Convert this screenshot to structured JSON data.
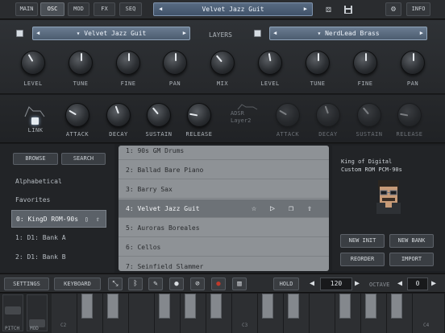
{
  "topbar": {
    "tabs": [
      {
        "label": "MAIN",
        "active": false
      },
      {
        "label": "OSC",
        "active": true
      },
      {
        "label": "MOD",
        "active": false
      },
      {
        "label": "FX",
        "active": false
      },
      {
        "label": "SEQ",
        "active": false
      }
    ],
    "preset_name": "Velvet Jazz Guit",
    "prev_arrow": "◀",
    "next_arrow": "▶",
    "dice_icon": "⚄",
    "save_icon": "💾",
    "gear_icon": "⚙",
    "info_label": "INFO"
  },
  "layers_label": "LAYERS",
  "osc_left": {
    "preset": "Velvet Jazz Guit",
    "knobs": [
      "LEVEL",
      "TUNE",
      "FINE",
      "PAN"
    ]
  },
  "mix_label": "MIX",
  "osc_right": {
    "preset": "NerdLead Brass",
    "knobs": [
      "LEVEL",
      "TUNE",
      "FINE",
      "PAN"
    ]
  },
  "env_left": {
    "link_label": "LINK",
    "knobs": [
      "ATTACK",
      "DECAY",
      "SUSTAIN",
      "RELEASE"
    ]
  },
  "env_right": {
    "adsr_line1": "ADSR",
    "adsr_line2": "Layer2",
    "knobs": [
      "ATTACK",
      "DECAY",
      "SUSTAIN",
      "RELEASE"
    ]
  },
  "browser": {
    "browse_label": "BROWSE",
    "search_label": "SEARCH",
    "categories": [
      "Alphabetical",
      "Favorites",
      "0: KingD ROM-90s",
      "1: D1: Bank A",
      "2: D1: Bank B"
    ],
    "selected_category": 2,
    "presets": [
      "1: 90s GM Drums",
      "2: Ballad Bare Piano",
      "3: Barry Sax",
      "4: Velvet Jazz Guit",
      "5: Auroras Boreales",
      "6: Cellos",
      "7: Seinfield Slammer"
    ],
    "selected_preset": 3
  },
  "info_panel": {
    "line1": "King of Digital",
    "line2": "Custom ROM PCM-90s",
    "buttons": [
      "NEW INIT",
      "NEW BANK",
      "REORDER",
      "IMPORT"
    ]
  },
  "bottombar": {
    "settings_label": "SETTINGS",
    "keyboard_label": "KEYBOARD",
    "hold_label": "HOLD",
    "tempo_value": "120",
    "octave_label": "OCTAVE",
    "octave_value": "0"
  },
  "keyboard": {
    "pitch_label": "PITCH",
    "mod_label": "MOD",
    "octave_labels": [
      "C2",
      "C3",
      "C4"
    ]
  },
  "colors": {
    "accent_select": "#5a6c82",
    "selected_row": "#6d7277",
    "list_bg": "#8e9296",
    "record": "#c0392b"
  }
}
